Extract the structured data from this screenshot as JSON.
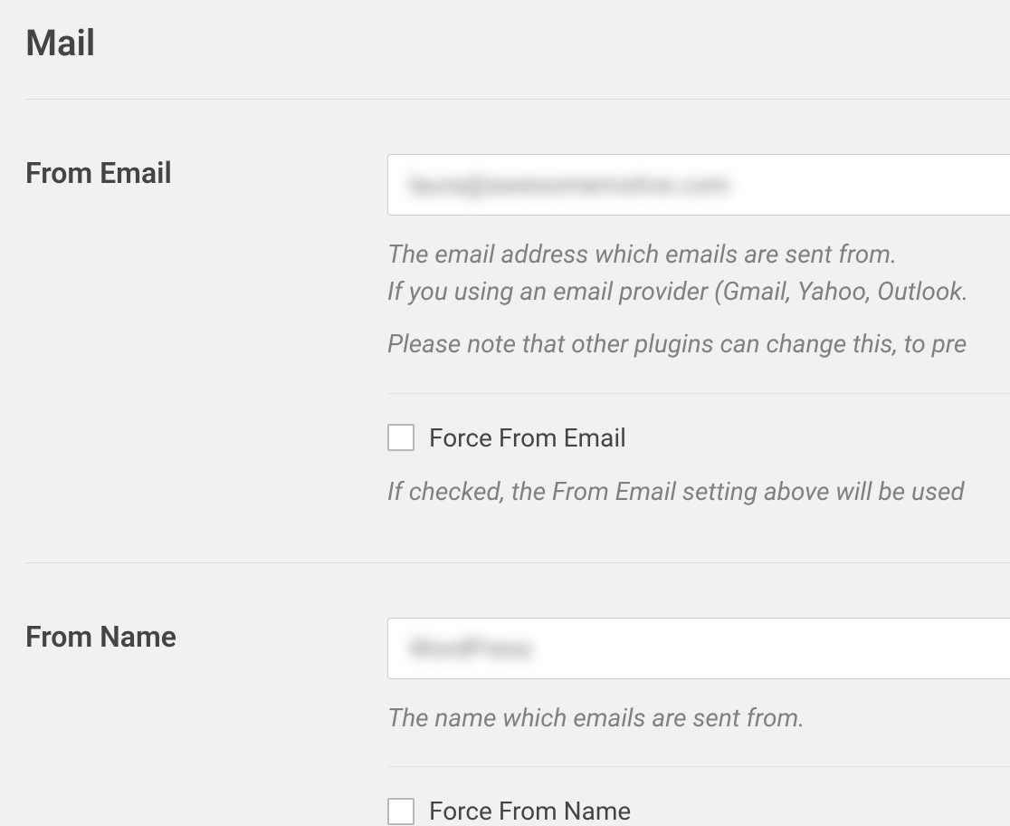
{
  "section": {
    "title": "Mail"
  },
  "from_email": {
    "label": "From Email",
    "value": "laura@awesomemotive.com",
    "desc_line1": "The email address which emails are sent from.",
    "desc_line2": "If you using an email provider (Gmail, Yahoo, Outlook.",
    "desc_line3": "Please note that other plugins can change this, to pre",
    "force_label": "Force From Email",
    "force_desc": "If checked, the From Email setting above will be used"
  },
  "from_name": {
    "label": "From Name",
    "value": "WordPress",
    "desc_line1": "The name which emails are sent from.",
    "force_label": "Force From Name"
  }
}
